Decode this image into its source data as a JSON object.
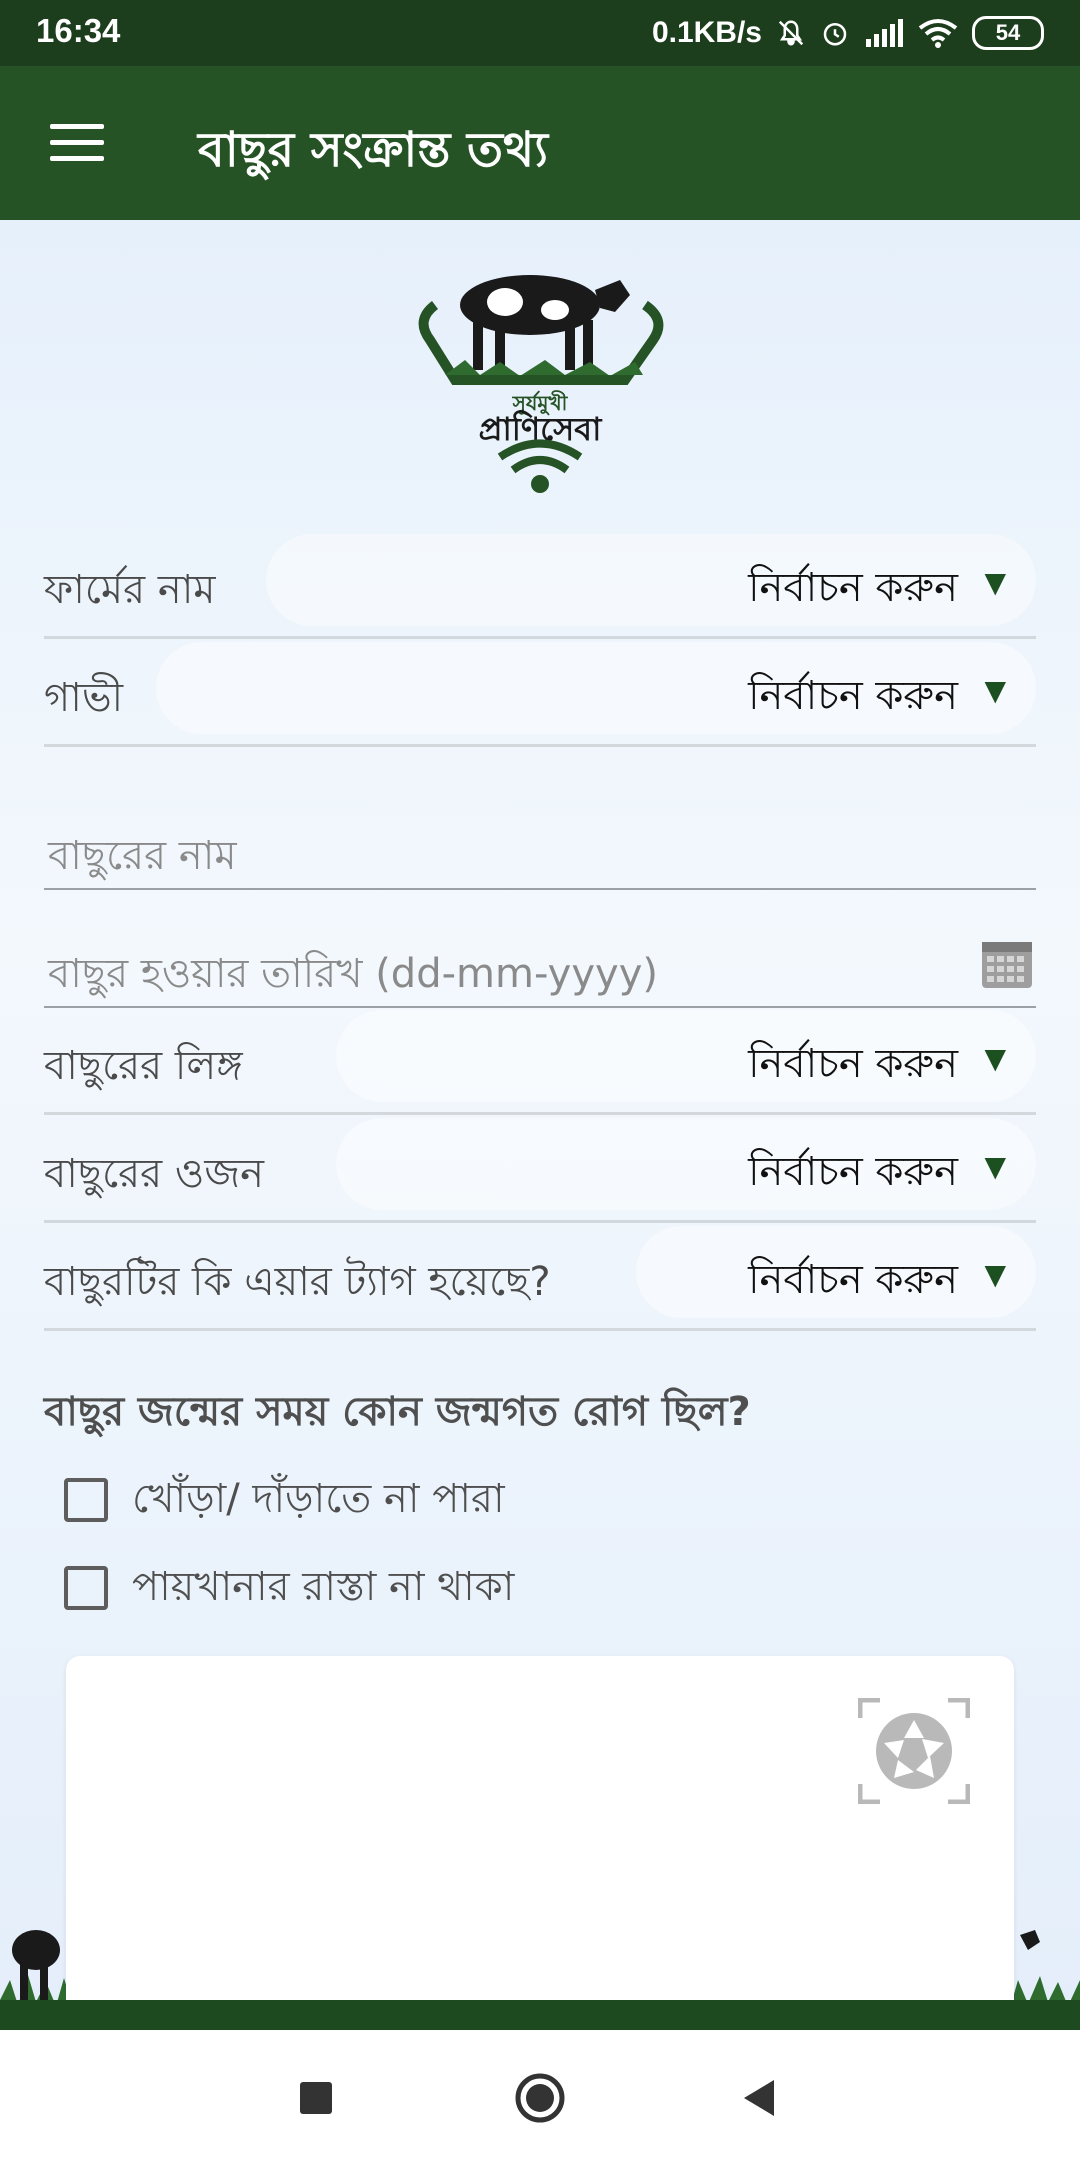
{
  "status_bar": {
    "time": "16:34",
    "net_speed": "0.1KB/s",
    "battery": "54"
  },
  "app_bar": {
    "title": "বাছুর সংক্রান্ত তথ্য"
  },
  "logo": {
    "text_top": "সূর্যমুখী",
    "text_main": "প্রাণিসেবা"
  },
  "form": {
    "farm": {
      "label": "ফার্মের নাম",
      "value": "নির্বাচন করুন"
    },
    "cow": {
      "label": "গাভী",
      "value": "নির্বাচন করুন"
    },
    "calf_name": {
      "placeholder": "বাছুরের নাম"
    },
    "birth_date": {
      "placeholder": "বাছুর হওয়ার তারিখ (dd-mm-yyyy)"
    },
    "gender": {
      "label": "বাছুরের লিঙ্গ",
      "value": "নির্বাচন করুন"
    },
    "weight": {
      "label": "বাছুরের ওজন",
      "value": "নির্বাচন করুন"
    },
    "ear_tag": {
      "label": "বাছুরটির কি এয়ার ট্যাগ হয়েছে?",
      "value": "নির্বাচন করুন"
    },
    "question": "বাছুর জন্মের সময় কোন জন্মগত রোগ ছিল?",
    "checkboxes": [
      "খোঁড়া/ দাঁড়াতে না পারা",
      "পায়খানার রাস্তা না থাকা"
    ]
  },
  "colors": {
    "status_bar": "#1d3e1d",
    "app_bar": "#255326",
    "accent": "#1d5020"
  },
  "icons": [
    "menu-icon",
    "dropdown-arrow-icon",
    "calendar-icon",
    "camera-icon",
    "stop-icon",
    "home-icon",
    "back-icon"
  ]
}
